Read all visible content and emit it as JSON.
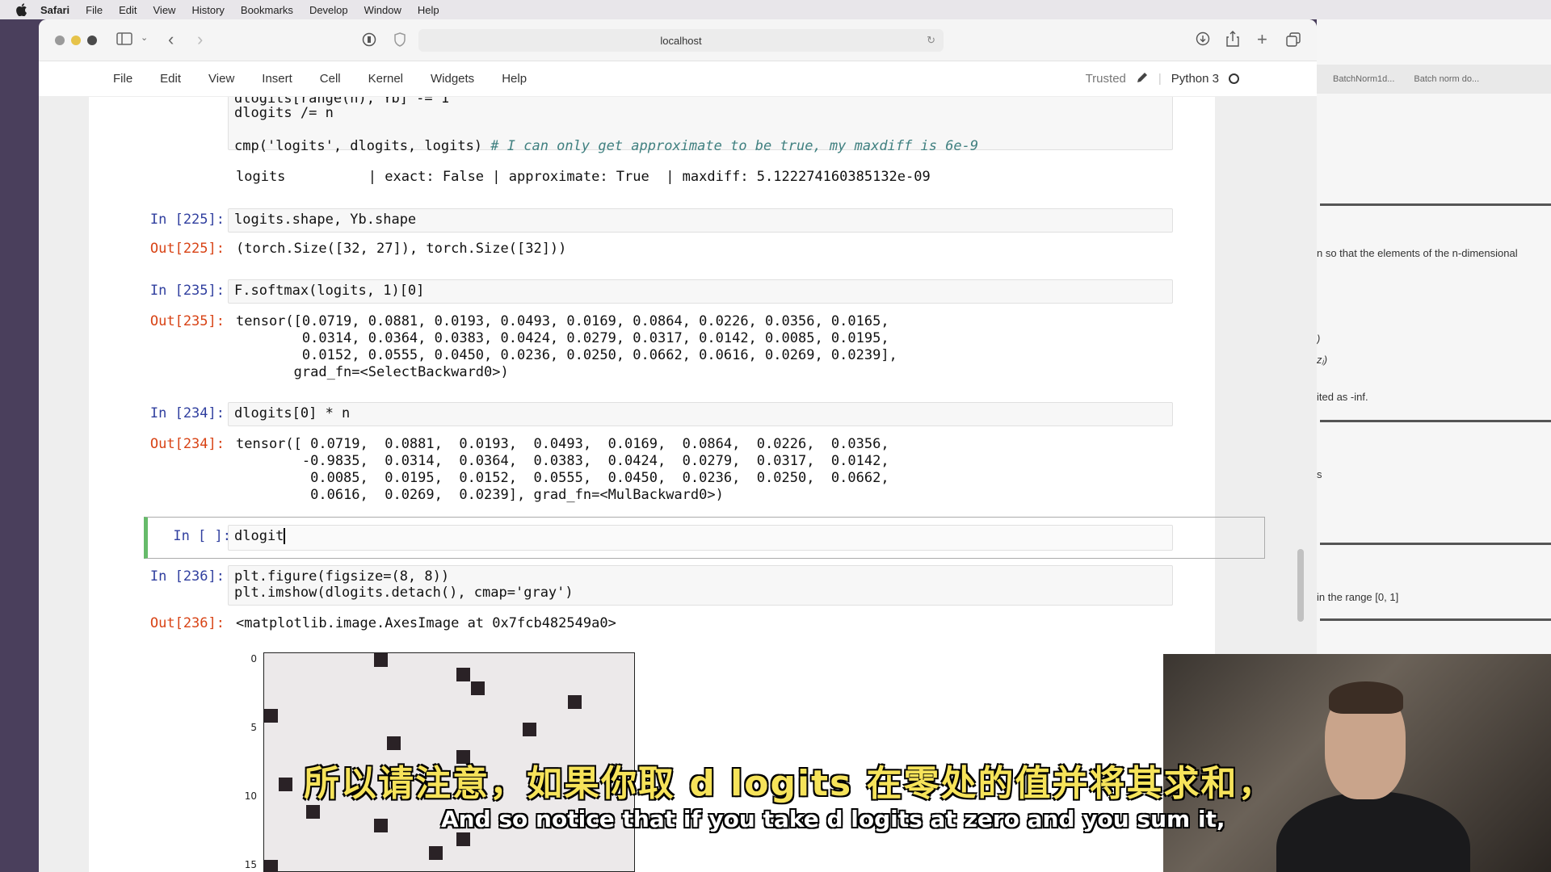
{
  "menubar": {
    "app": "Safari",
    "items": [
      "File",
      "Edit",
      "View",
      "History",
      "Bookmarks",
      "Develop",
      "Window",
      "Help"
    ]
  },
  "browser": {
    "url": "localhost"
  },
  "jupyter": {
    "menu": [
      "File",
      "Edit",
      "View",
      "Insert",
      "Cell",
      "Kernel",
      "Widgets",
      "Help"
    ],
    "trusted": "Trusted",
    "kernel": "Python 3"
  },
  "cells": {
    "c0_line1": "dlogits[range(n), Yb] -= 1",
    "c0_line2": "dlogits /= n",
    "c0_line3_code": "cmp('logits', dlogits, logits) ",
    "c0_line3_comment": "# I can only get approximate to be true, my maxdiff is 6e-9",
    "c0_out": "logits          | exact: False | approximate: True  | maxdiff: 5.122274160385132e-09",
    "c225_in_prompt": "In [225]:",
    "c225_code": "logits.shape, Yb.shape",
    "c225_out_prompt": "Out[225]:",
    "c225_out": "(torch.Size([32, 27]), torch.Size([32]))",
    "c235_in_prompt": "In [235]:",
    "c235_code": "F.softmax(logits, 1)[0]",
    "c235_out_prompt": "Out[235]:",
    "c235_out_l1": "tensor([0.0719, 0.0881, 0.0193, 0.0493, 0.0169, 0.0864, 0.0226, 0.0356, 0.0165,",
    "c235_out_l2": "        0.0314, 0.0364, 0.0383, 0.0424, 0.0279, 0.0317, 0.0142, 0.0085, 0.0195,",
    "c235_out_l3": "        0.0152, 0.0555, 0.0450, 0.0236, 0.0250, 0.0662, 0.0616, 0.0269, 0.0239],",
    "c235_out_l4": "       grad_fn=<SelectBackward0>)",
    "c234_in_prompt": "In [234]:",
    "c234_code": "dlogits[0] * n",
    "c234_out_prompt": "Out[234]:",
    "c234_out_l1": "tensor([ 0.0719,  0.0881,  0.0193,  0.0493,  0.0169,  0.0864,  0.0226,  0.0356,",
    "c234_out_l2": "        -0.9835,  0.0314,  0.0364,  0.0383,  0.0424,  0.0279,  0.0317,  0.0142,",
    "c234_out_l3": "         0.0085,  0.0195,  0.0152,  0.0555,  0.0450,  0.0236,  0.0250,  0.0662,",
    "c234_out_l4": "         0.0616,  0.0269,  0.0239], grad_fn=<MulBackward0>)",
    "active_prompt": "In [ ]:",
    "active_code": "dlogit",
    "c236_in_prompt": "In [236]:",
    "c236_line1": "plt.figure(figsize=(8, 8))",
    "c236_line2": "plt.imshow(dlogits.detach(), cmap='gray')",
    "c236_out_prompt": "Out[236]:",
    "c236_out": "<matplotlib.image.AxesImage at 0x7fcb482549a0>"
  },
  "plot": {
    "yticks": [
      "0",
      "5",
      "10",
      "15"
    ]
  },
  "right_panel": {
    "tab1": "BatchNorm1d...",
    "tab2": "Batch norm do...",
    "t1": "n so that the elements of the n-dimensional",
    "t2": ")",
    "t3": "zⱼ)",
    "t4": "ited as -inf.",
    "t5": "s",
    "t6": "in the range [0, 1]"
  },
  "subtitles": {
    "cn": "所以请注意，如果你取 d logits 在零处的值并将其求和，",
    "en": "And so notice that if you take d logits at zero and you sum it,"
  },
  "colors": {
    "subtitle_cn": "#f6e35a",
    "prompt_in": "#303f9f",
    "prompt_out": "#d84315",
    "active_cell_bar": "#66bb6a"
  }
}
